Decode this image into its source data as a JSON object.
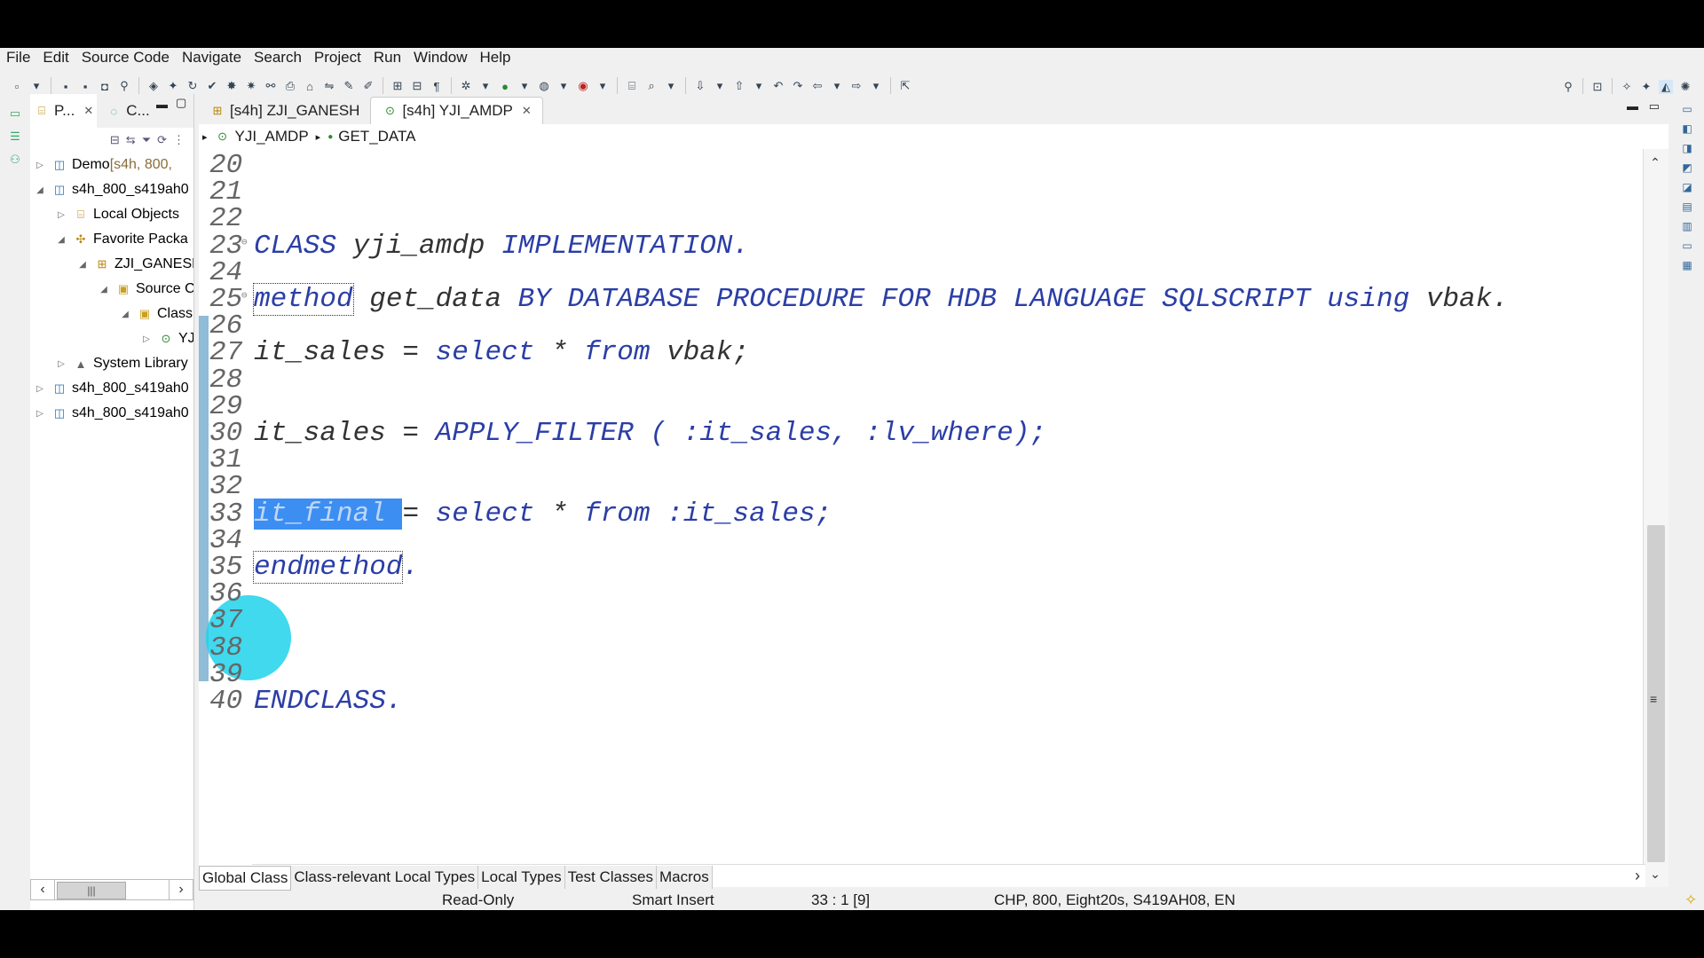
{
  "menu": [
    "File",
    "Edit",
    "Source Code",
    "Navigate",
    "Search",
    "Project",
    "Run",
    "Window",
    "Help"
  ],
  "left_panel": {
    "tabs": [
      {
        "label": "P...",
        "icon": "project-explorer-icon"
      },
      {
        "label": "C...",
        "icon": "class-outline-icon"
      }
    ],
    "tree": [
      {
        "label": "Demo",
        "suffix": " [s4h, 800,",
        "level": 0,
        "twisty": "collapsed",
        "icon": "abap-project-icon"
      },
      {
        "label": "s4h_800_s419ah0",
        "level": 0,
        "twisty": "expanded",
        "icon": "abap-project-icon"
      },
      {
        "label": "Local Objects",
        "level": 1,
        "twisty": "collapsed",
        "icon": "local-objects-icon"
      },
      {
        "label": "Favorite Packa",
        "level": 1,
        "twisty": "expanded",
        "icon": "favorite-packages-icon"
      },
      {
        "label": "ZJI_GANESH",
        "level": 2,
        "twisty": "expanded",
        "icon": "package-icon"
      },
      {
        "label": "Source C",
        "level": 3,
        "twisty": "expanded",
        "icon": "folder-icon"
      },
      {
        "label": "Class",
        "level": 4,
        "twisty": "expanded",
        "icon": "folder-icon"
      },
      {
        "label": "YJI_AMDP",
        "level": 5,
        "twisty": "collapsed",
        "icon": "class-icon"
      },
      {
        "label": "System Library",
        "level": 1,
        "twisty": "collapsed",
        "icon": "system-library-icon"
      },
      {
        "label": "s4h_800_s419ah0",
        "level": 0,
        "twisty": "collapsed",
        "icon": "abap-project-icon"
      },
      {
        "label": "s4h_800_s419ah0",
        "level": 0,
        "twisty": "collapsed",
        "icon": "abap-project-icon"
      }
    ]
  },
  "editor": {
    "tabs": [
      {
        "label": "[s4h] ZJI_GANESH",
        "active": false
      },
      {
        "label": "[s4h] YJI_AMDP",
        "active": true
      }
    ],
    "breadcrumb": [
      "YJI_AMDP",
      "GET_DATA"
    ],
    "lines": [
      {
        "num": "20",
        "segs": []
      },
      {
        "num": "21",
        "segs": []
      },
      {
        "num": "22",
        "segs": []
      },
      {
        "num": "23",
        "fold": true,
        "segs": [
          {
            "t": "CLASS",
            "c": "kw"
          },
          {
            "t": " yji_amdp ",
            "c": ""
          },
          {
            "t": "IMPLEMENTATION.",
            "c": "kw"
          }
        ]
      },
      {
        "num": "24",
        "segs": []
      },
      {
        "num": "25",
        "fold": true,
        "segs": [
          {
            "t": "method",
            "c": "kw boxed"
          },
          {
            "t": " get_data ",
            "c": ""
          },
          {
            "t": "BY DATABASE PROCEDURE FOR HDB LANGUAGE SQLSCRIPT using",
            "c": "kw"
          },
          {
            "t": " vbak.",
            "c": ""
          }
        ]
      },
      {
        "num": "26",
        "segs": []
      },
      {
        "num": "27",
        "segs": [
          {
            "t": "it_sales = ",
            "c": ""
          },
          {
            "t": "select",
            "c": "kw"
          },
          {
            "t": " * ",
            "c": ""
          },
          {
            "t": "from",
            "c": "kw"
          },
          {
            "t": " vbak;",
            "c": ""
          }
        ]
      },
      {
        "num": "28",
        "segs": []
      },
      {
        "num": "29",
        "segs": []
      },
      {
        "num": "30",
        "segs": [
          {
            "t": "it_sales = ",
            "c": ""
          },
          {
            "t": "APPLY_FILTER ( :it_sales, :lv_where);",
            "c": "kw"
          }
        ]
      },
      {
        "num": "31",
        "segs": []
      },
      {
        "num": "32",
        "segs": []
      },
      {
        "num": "33",
        "segs": [
          {
            "t": "it_final ",
            "c": "sel"
          },
          {
            "t": "= ",
            "c": ""
          },
          {
            "t": "select",
            "c": "kw"
          },
          {
            "t": " * ",
            "c": ""
          },
          {
            "t": "from",
            "c": "kw"
          },
          {
            "t": " :it_sales;",
            "c": "kw"
          }
        ]
      },
      {
        "num": "34",
        "segs": []
      },
      {
        "num": "35",
        "segs": [
          {
            "t": "endmethod",
            "c": "kw boxed"
          },
          {
            "t": ".",
            "c": "kw"
          }
        ]
      },
      {
        "num": "36",
        "segs": []
      },
      {
        "num": "37",
        "segs": []
      },
      {
        "num": "38",
        "segs": []
      },
      {
        "num": "39",
        "segs": []
      },
      {
        "num": "40",
        "segs": [
          {
            "t": "ENDCLASS.",
            "c": "kw"
          }
        ]
      }
    ],
    "bottom_tabs": [
      "Global Class",
      "Class-relevant Local Types",
      "Local Types",
      "Test Classes",
      "Macros"
    ],
    "active_bottom_tab": "Global Class"
  },
  "status": {
    "mode": "Read-Only",
    "insert": "Smart Insert",
    "position": "33 : 1 [9]",
    "system": "CHP, 800, Eight20s, S419AH08, EN"
  },
  "colors": {
    "keyword": "#2b3ea6",
    "selection": "#3d8ef2",
    "cursor_highlight": "#1ed2eb"
  }
}
